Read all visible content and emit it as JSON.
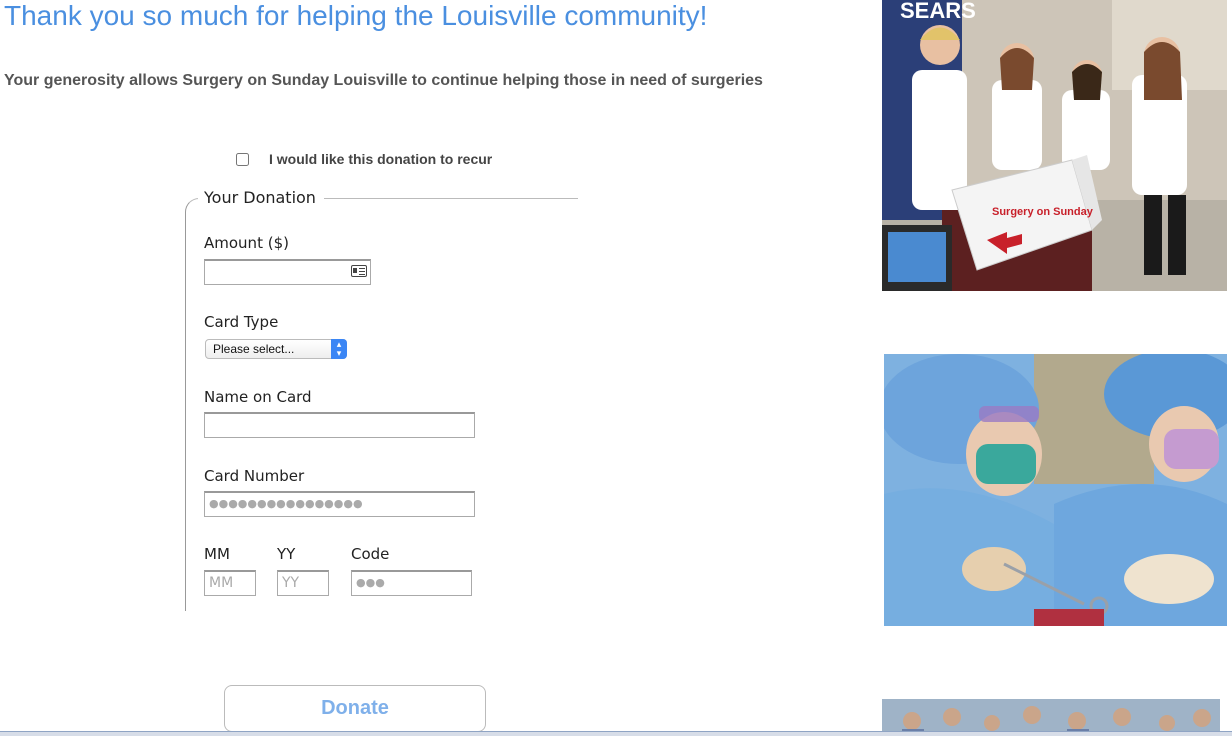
{
  "header": {
    "title": "Thank you so much for helping the Louisville community!",
    "subtitle": "Your generosity allows Surgery on Sunday Louisville to continue helping those in need of surgeries"
  },
  "recur": {
    "label": "I would like this donation to recur",
    "checked": false
  },
  "donation": {
    "legend": "Your Donation",
    "amount_label": "Amount ($)",
    "amount_value": "",
    "card_type_label": "Card Type",
    "card_type_selected": "Please select...",
    "name_label": "Name on Card",
    "name_value": "",
    "card_number_label": "Card Number",
    "card_number_placeholder": "●●●●●●●●●●●●●●●●",
    "mm_label": "MM",
    "mm_placeholder": "MM",
    "yy_label": "YY",
    "yy_placeholder": "YY",
    "code_label": "Code",
    "code_placeholder": "●●●"
  },
  "donate_button": "Donate",
  "photos": {
    "volunteers": {
      "sign_text": "SEARS",
      "box_text": "Surgery on Sunday"
    },
    "surgery": {},
    "team": {}
  },
  "colors": {
    "title": "#4a8fe0",
    "button_text": "#7fb0ea",
    "select_accent": "#3b86f5"
  }
}
